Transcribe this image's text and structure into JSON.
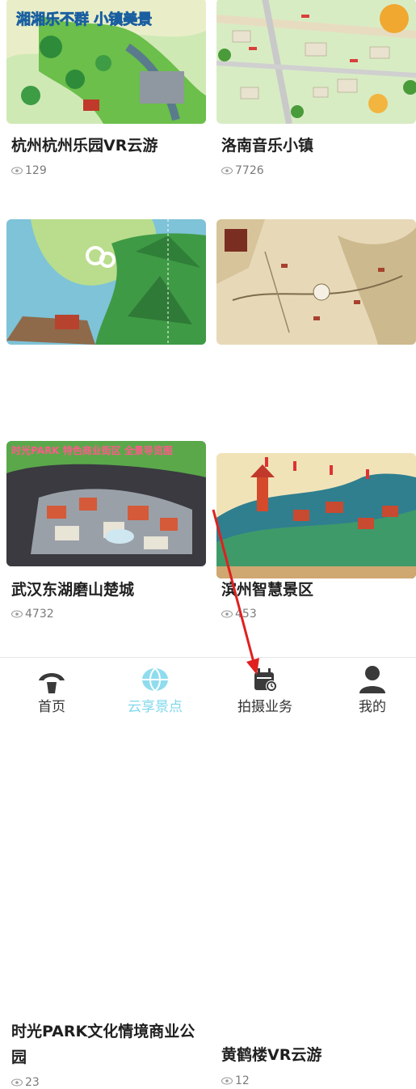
{
  "cards": [
    {
      "title": "杭州杭州乐园VR云游",
      "views": "129",
      "thumb_text": "湘湘乐不群 小镇美景",
      "thumb_icon": "park-map-icon"
    },
    {
      "title": "洛南音乐小镇",
      "views": "7726",
      "thumb_icon": "town-map-icon"
    },
    {
      "title": "武汉东湖磨山楚城",
      "views": "4732",
      "thumb_icon": "mountain-map-icon"
    },
    {
      "title": "滨州智慧景区",
      "views": "453",
      "thumb_icon": "old-map-icon"
    },
    {
      "title": "时光PARK文化情境商业公园",
      "views": "23",
      "thumb_text": "时光PARK 特色商业街区 全景导览图",
      "thumb_icon": "commercial-park-map-icon"
    },
    {
      "title": "黄鹤楼VR云游",
      "views": "12",
      "thumb_icon": "pagoda-map-icon"
    }
  ],
  "tabs": [
    {
      "label": "首页",
      "icon": "home-icon",
      "active": false
    },
    {
      "label": "云享景点",
      "icon": "globe-icon",
      "active": true
    },
    {
      "label": "拍摄业务",
      "icon": "camera-calendar-icon",
      "active": false
    },
    {
      "label": "我的",
      "icon": "user-icon",
      "active": false
    }
  ],
  "colors": {
    "active_tab": "#7fd8ec",
    "title": "#1f1f1f",
    "meta": "#7a7a7a",
    "annotation_arrow": "#e02020"
  }
}
